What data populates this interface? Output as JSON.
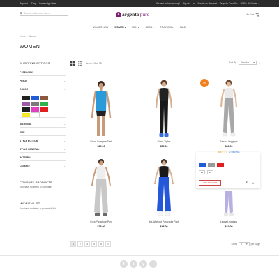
{
  "topbar": {
    "left": [
      "Support",
      "Faq",
      "Knowledge Base"
    ],
    "right": [
      "Default welcome msg!",
      "Sign In",
      "or",
      "Create an Account",
      "Argento Pure 2 ▾",
      "USD - US Dollar ▾"
    ]
  },
  "header": {
    "search_placeholder": "Search entire store here...",
    "logo_mark": "a",
    "logo_a": "argento",
    "logo_b": "pure",
    "cart_label": "My Cart"
  },
  "nav": [
    "WHAT'S NEW",
    "WOMEN ▾",
    "MEN ▾",
    "GEAR ▾",
    "TRAINING ▾",
    "SALE"
  ],
  "breadcrumb": {
    "home": "Home",
    "sep": ">",
    "current": "Women"
  },
  "page_title": "WOMEN",
  "sidebar": {
    "shopping_options": "SHOPPING OPTIONS",
    "filters_top": [
      "CATEGORY",
      "PRICE",
      "COLOR"
    ],
    "swatch_colors": [
      "#222222",
      "#1f5cd6",
      "#8b5a3c",
      "#a05aa8",
      "#7a7a7a",
      "#2db34a",
      "#1e1e1e",
      "#e040c0",
      "#e02020",
      "#f5e72a",
      "#ffffff"
    ],
    "filters_bottom": [
      "MATERIAL",
      "SIZE",
      "STYLE BOTTOM",
      "STYLE GENERAL",
      "PATTERN",
      "CLIMATE"
    ],
    "compare_title": "COMPARE PRODUCTS",
    "compare_text": "You have no items to compare.",
    "wishlist_title": "MY WISH LIST",
    "wishlist_text": "You have no items in your wish list."
  },
  "toolbar": {
    "items_text": "Items 1-9 of 75",
    "sort_label": "Sort By",
    "sort_value": "Position"
  },
  "products": [
    {
      "name": "Chloe Compete Tank",
      "price": "$39.00"
    },
    {
      "name": "Diana Tights",
      "price": "$59.00"
    },
    {
      "name": "Sahara Leggings",
      "price": "$60.00"
    },
    {
      "name": "Cora Parachute Pant",
      "price": "$75.00"
    },
    {
      "name": "Ida Workout Parachute Pant",
      "price": "$48.00"
    },
    {
      "name": "Leona Leggings",
      "price": "$42.00"
    }
  ],
  "featured": {
    "badge": "-5%",
    "reviews": "2 Reviews",
    "stars": "★★★★★",
    "colors": [
      "#1f5cd6",
      "#9a9a9a",
      "#e02020"
    ],
    "sizes": [
      "28",
      "29"
    ],
    "add_to_cart": "ADD TO CART"
  },
  "pager": {
    "pages": [
      "1",
      "2",
      "3",
      "4",
      "5"
    ],
    "next": ">",
    "show_label": "Show",
    "show_value": "9",
    "per_page": "per page"
  },
  "social": [
    "f",
    "t",
    "y",
    "i"
  ]
}
